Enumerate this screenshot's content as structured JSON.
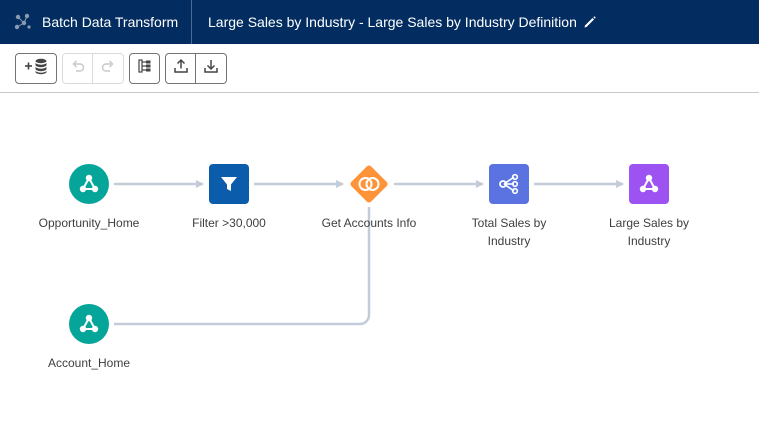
{
  "header": {
    "app_title": "Batch Data Transform",
    "recipe_title": "Large Sales by Industry - Large Sales by Industry Definition",
    "background_color": "#032d60"
  },
  "toolbar": {
    "buttons": [
      {
        "id": "add-input",
        "icon": "add-database-icon"
      },
      {
        "id": "undo",
        "icon": "undo-icon",
        "disabled": true
      },
      {
        "id": "redo",
        "icon": "redo-icon",
        "disabled": true
      },
      {
        "id": "auto-layout",
        "icon": "hierarchy-icon"
      },
      {
        "id": "upload",
        "icon": "upload-icon"
      },
      {
        "id": "download",
        "icon": "download-icon"
      }
    ]
  },
  "nodes": [
    {
      "id": "opportunity_home",
      "label": "Opportunity_Home",
      "type": "input",
      "icon": "dataset-icon",
      "color": "#06a59a"
    },
    {
      "id": "filter",
      "label": "Filter >30,000",
      "type": "filter",
      "icon": "filter-icon",
      "color": "#0b5cab"
    },
    {
      "id": "join",
      "label": "Get Accounts Info",
      "type": "join",
      "icon": "join-icon",
      "color": "#fe9339"
    },
    {
      "id": "aggregate",
      "label": "Total Sales by Industry",
      "type": "aggregate",
      "icon": "aggregate-icon",
      "color": "#5a73e0"
    },
    {
      "id": "output",
      "label": "Large Sales by Industry",
      "type": "output",
      "icon": "output-dataset-icon",
      "color": "#9d53f2"
    },
    {
      "id": "account_home",
      "label": "Account_Home",
      "type": "input",
      "icon": "dataset-icon",
      "color": "#06a59a"
    }
  ],
  "connector_color": "#c3ccd8"
}
